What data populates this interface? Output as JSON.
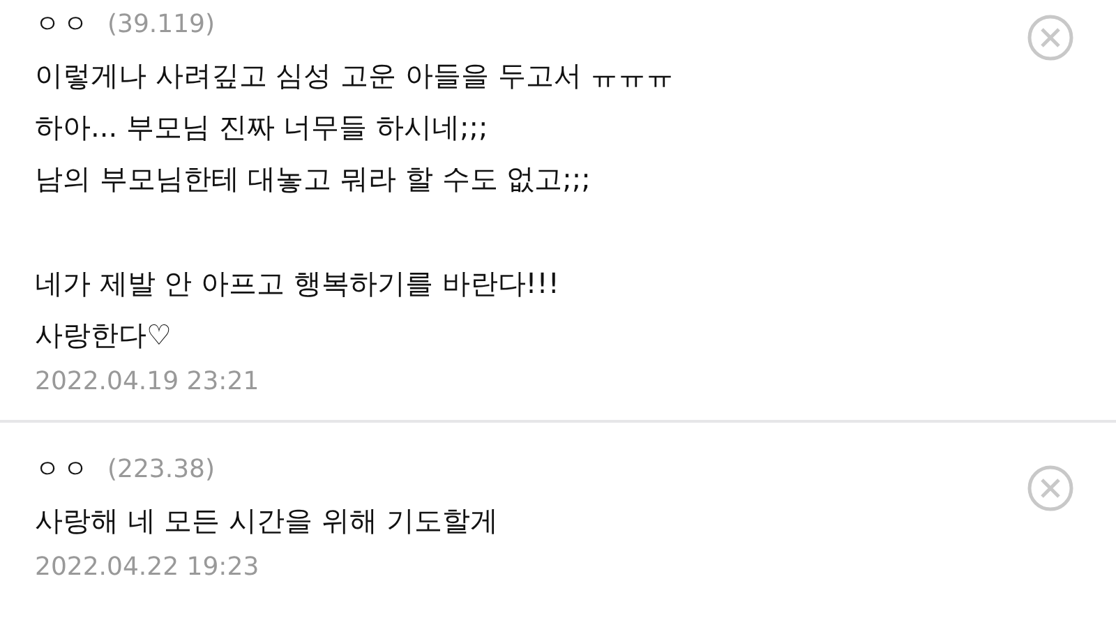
{
  "comments": [
    {
      "author": "ㅇㅇ",
      "ip": "(39.119)",
      "paragraphs": [
        [
          "이렇게나 사려깊고 심성 고운 아들을 두고서 ㅠㅠㅠ",
          "하아... 부모님 진짜 너무들 하시네;;;",
          "남의 부모님한테 대놓고 뭐라 할 수도 없고;;;"
        ],
        [
          "네가 제발 안 아프고 행복하기를 바란다!!!",
          "사랑한다♡"
        ]
      ],
      "date": "2022.04.19 23:21"
    },
    {
      "author": "ㅇㅇ",
      "ip": "(223.38)",
      "paragraphs": [
        [
          "사랑해 네 모든 시간을 위해 기도할게"
        ]
      ],
      "date": "2022.04.22 19:23"
    }
  ]
}
